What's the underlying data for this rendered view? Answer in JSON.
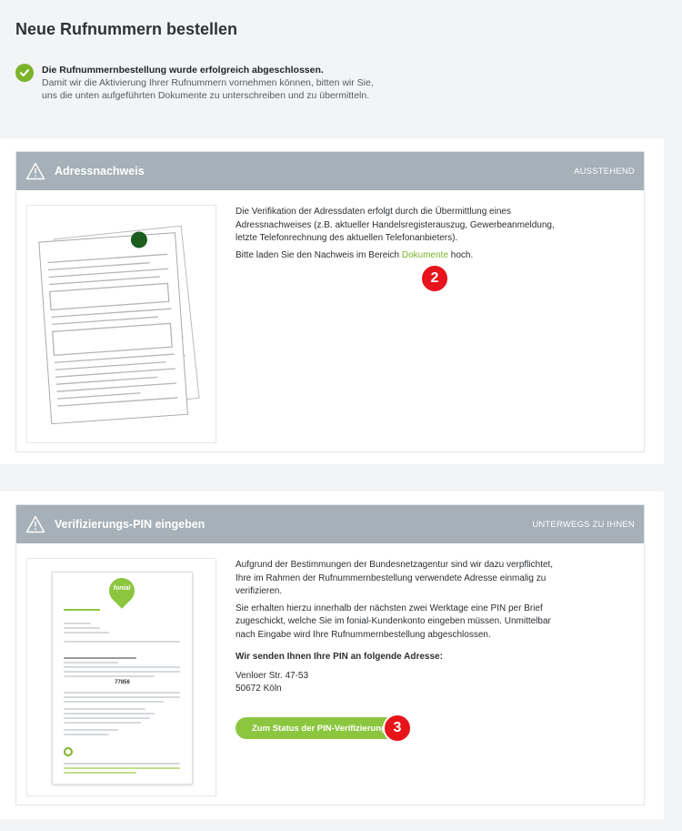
{
  "page": {
    "title": "Neue Rufnummern bestellen"
  },
  "success": {
    "headline": "Die Rufnummernbestellung wurde erfolgreich abgeschlossen.",
    "line1": "Damit wir die Aktivierung Ihrer Rufnummern vornehmen können, bitten wir Sie,",
    "line2": "uns die unten aufgeführten Dokumente zu unterschreiben und zu übermitteln."
  },
  "address_card": {
    "title": "Adressnachweis",
    "status": "AUSSTEHEND",
    "p1": "Die Verifikation der Adressdaten erfolgt durch die Übermittlung eines Adressnachweises (z.B. aktueller Handelsregisterauszug, Gewerbeanmeldung, letzte Telefonrechnung des aktuellen Telefonanbieters).",
    "p2_before": "Bitte laden Sie den Nachweis im Bereich ",
    "p2_link": "Dokumente",
    "p2_after": " hoch.",
    "badge": "2"
  },
  "pin_card": {
    "title": "Verifizierungs-PIN eingeben",
    "status": "UNTERWEGS ZU IHNEN",
    "p1": "Aufgrund der Bestimmungen der Bundesnetzagentur sind wir dazu verpflichtet, Ihre im Rahmen der Rufnummernbestellung verwendete Adresse einmalig zu verifizieren.",
    "p2": "Sie erhalten hierzu innerhalb der nächsten zwei Werktage eine PIN per Brief zugeschickt, welche Sie im fonial-Kundenkonto eingeben müssen. Unmittelbar nach Eingabe wird Ihre Rufnummernbestellung abgeschlossen.",
    "address_heading": "Wir senden Ihnen Ihre PIN an folgende Adresse:",
    "street": "Venloer Str. 47-53",
    "city": "50672 Köln",
    "button": "Zum Status der PIN-Verifizierung",
    "badge": "3",
    "logo_text": "fonial",
    "pin_code": "77856"
  },
  "colors": {
    "accent": "#8cc63f",
    "header": "#a5b0b8",
    "badge": "#e8141b"
  }
}
